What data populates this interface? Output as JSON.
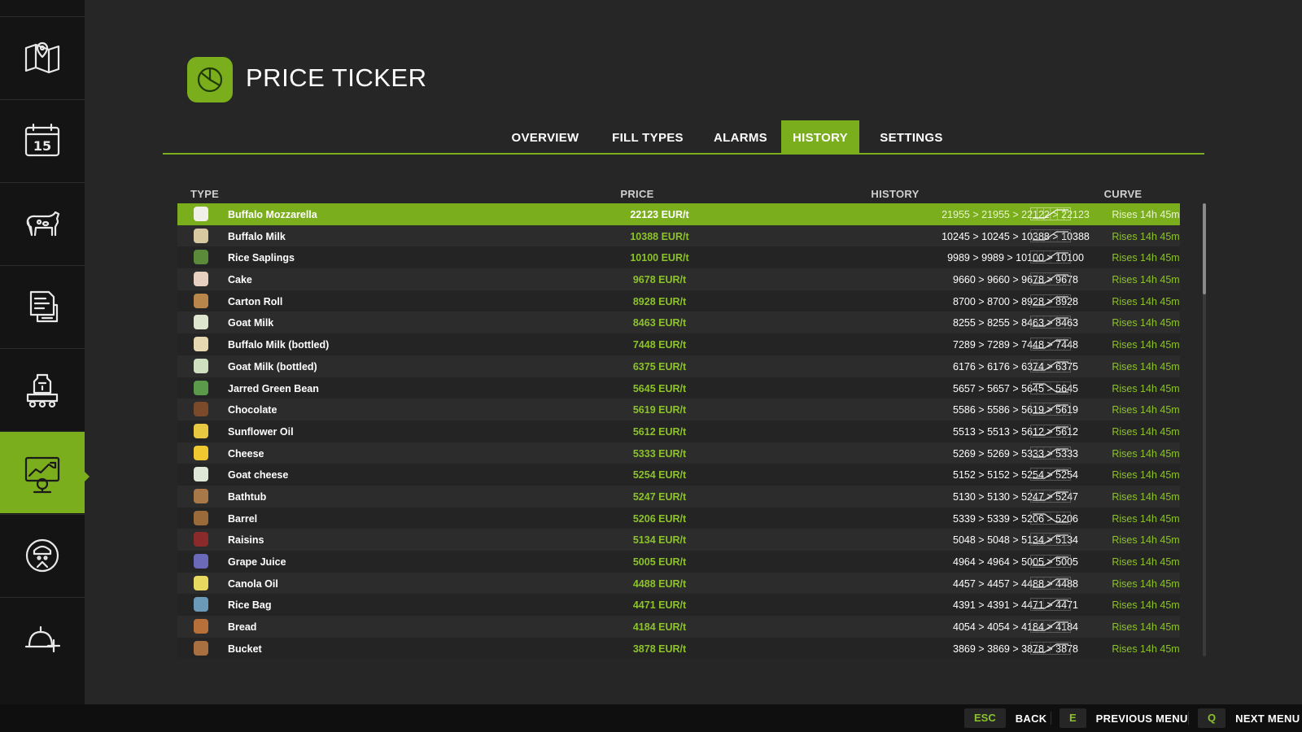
{
  "header": {
    "title": "PRICE TICKER"
  },
  "tabs": [
    {
      "label": "OVERVIEW",
      "active": false
    },
    {
      "label": "FILL TYPES",
      "active": false
    },
    {
      "label": "ALARMS",
      "active": false
    },
    {
      "label": "HISTORY",
      "active": true
    },
    {
      "label": "SETTINGS",
      "active": false
    }
  ],
  "sidebar": {
    "items": [
      {
        "icon": "map-icon"
      },
      {
        "icon": "calendar-icon",
        "date": "15"
      },
      {
        "icon": "animals-icon"
      },
      {
        "icon": "contracts-icon"
      },
      {
        "icon": "production-icon"
      },
      {
        "icon": "price-chart-icon",
        "active": true
      },
      {
        "icon": "worker-icon"
      },
      {
        "icon": "help-icon"
      }
    ]
  },
  "table": {
    "headers": {
      "type": "TYPE",
      "price": "PRICE",
      "history": "HISTORY",
      "curve": "CURVE"
    },
    "rows": [
      {
        "name": "Buffalo Mozzarella",
        "price": "22123 EUR/t",
        "history": "21955 > 21955 > 22122 > 22123",
        "trend": "Rises 14h 45m",
        "icon_color": "#f0f0e8",
        "selected": true
      },
      {
        "name": "Buffalo Milk",
        "price": "10388 EUR/t",
        "history": "10245 > 10245 > 10388 > 10388",
        "trend": "Rises 14h 45m",
        "icon_color": "#d8c9a0"
      },
      {
        "name": "Rice Saplings",
        "price": "10100 EUR/t",
        "history": "9989 > 9989 > 10100 > 10100",
        "trend": "Rises 14h 45m",
        "icon_color": "#5a8a3a"
      },
      {
        "name": "Cake",
        "price": "9678 EUR/t",
        "history": "9660 > 9660 > 9678 > 9678",
        "trend": "Rises 14h 45m",
        "icon_color": "#e8d0c0"
      },
      {
        "name": "Carton Roll",
        "price": "8928 EUR/t",
        "history": "8700 > 8700 > 8928 > 8928",
        "trend": "Rises 14h 45m",
        "icon_color": "#b8864a"
      },
      {
        "name": "Goat Milk",
        "price": "8463 EUR/t",
        "history": "8255 > 8255 > 8463 > 8463",
        "trend": "Rises 14h 45m",
        "icon_color": "#dfe6d0"
      },
      {
        "name": "Buffalo Milk (bottled)",
        "price": "7448 EUR/t",
        "history": "7289 > 7289 > 7448 > 7448",
        "trend": "Rises 14h 45m",
        "icon_color": "#e6d8b0"
      },
      {
        "name": "Goat Milk (bottled)",
        "price": "6375 EUR/t",
        "history": "6176 > 6176 > 6374 > 6375",
        "trend": "Rises 14h 45m",
        "icon_color": "#cfe0c0"
      },
      {
        "name": "Jarred Green Bean",
        "price": "5645 EUR/t",
        "history": "5657 > 5657 > 5645 > 5645",
        "trend": "Rises 14h 45m",
        "icon_color": "#5a9a4a"
      },
      {
        "name": "Chocolate",
        "price": "5619 EUR/t",
        "history": "5586 > 5586 > 5619 > 5619",
        "trend": "Rises 14h 45m",
        "icon_color": "#7a4a2a"
      },
      {
        "name": "Sunflower Oil",
        "price": "5612 EUR/t",
        "history": "5513 > 5513 > 5612 > 5612",
        "trend": "Rises 14h 45m",
        "icon_color": "#e8c840"
      },
      {
        "name": "Cheese",
        "price": "5333 EUR/t",
        "history": "5269 > 5269 > 5333 > 5333",
        "trend": "Rises 14h 45m",
        "icon_color": "#f0c830"
      },
      {
        "name": "Goat cheese",
        "price": "5254 EUR/t",
        "history": "5152 > 5152 > 5254 > 5254",
        "trend": "Rises 14h 45m",
        "icon_color": "#dfe8d8"
      },
      {
        "name": "Bathtub",
        "price": "5247 EUR/t",
        "history": "5130 > 5130 > 5247 > 5247",
        "trend": "Rises 14h 45m",
        "icon_color": "#a87848"
      },
      {
        "name": "Barrel",
        "price": "5206 EUR/t",
        "history": "5339 > 5339 > 5206 > 5206",
        "trend": "Rises 14h 45m",
        "icon_color": "#9a6a3a"
      },
      {
        "name": "Raisins",
        "price": "5134 EUR/t",
        "history": "5048 > 5048 > 5134 > 5134",
        "trend": "Rises 14h 45m",
        "icon_color": "#8a2a2a"
      },
      {
        "name": "Grape Juice",
        "price": "5005 EUR/t",
        "history": "4964 > 4964 > 5005 > 5005",
        "trend": "Rises 14h 45m",
        "icon_color": "#6a6ab8"
      },
      {
        "name": "Canola Oil",
        "price": "4488 EUR/t",
        "history": "4457 > 4457 > 4488 > 4488",
        "trend": "Rises 14h 45m",
        "icon_color": "#e8d860"
      },
      {
        "name": "Rice Bag",
        "price": "4471 EUR/t",
        "history": "4391 > 4391 > 4471 > 4471",
        "trend": "Rises 14h 45m",
        "icon_color": "#6a9ab8"
      },
      {
        "name": "Bread",
        "price": "4184 EUR/t",
        "history": "4054 > 4054 > 4184 > 4184",
        "trend": "Rises 14h 45m",
        "icon_color": "#b8703a"
      },
      {
        "name": "Bucket",
        "price": "3878 EUR/t",
        "history": "3869 > 3869 > 3878 > 3878",
        "trend": "Rises 14h 45m",
        "icon_color": "#a87040"
      }
    ]
  },
  "footer": {
    "buttons": [
      {
        "key": "ESC",
        "label": "BACK"
      },
      {
        "key": "E",
        "label": "PREVIOUS MENU"
      },
      {
        "key": "Q",
        "label": "NEXT MENU"
      }
    ]
  },
  "colors": {
    "accent": "#7bae1c",
    "price_text": "#8cc22a",
    "background": "#262626",
    "sidebar": "#141414"
  }
}
